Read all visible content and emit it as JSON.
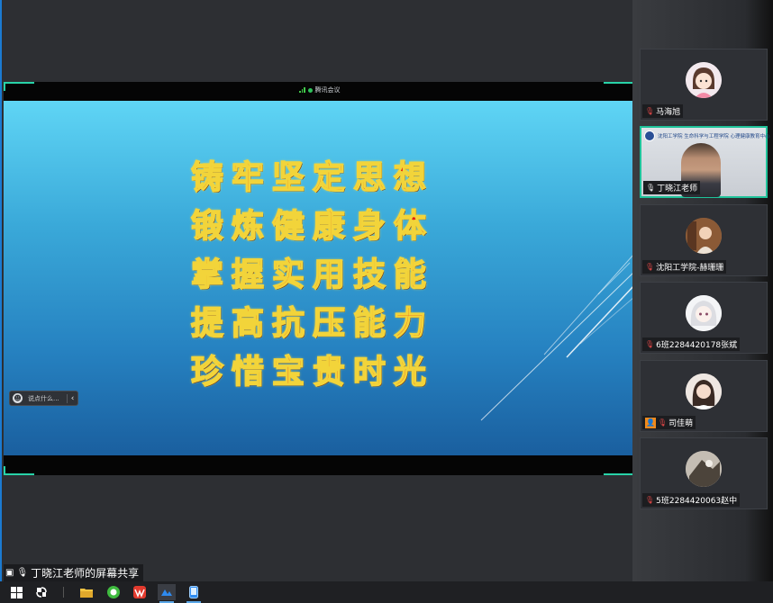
{
  "meeting": {
    "app_badge": "腾讯会议",
    "share_label": "丁晓江老师的屏幕共享"
  },
  "slide": {
    "lines": [
      "铸牢坚定思想",
      "锻炼健康身体",
      "掌握实用技能",
      "提高抗压能力",
      "珍惜宝贵时光"
    ]
  },
  "chat": {
    "placeholder": "说点什么..."
  },
  "participants": [
    {
      "name": "马海旭",
      "muted": true,
      "avatar": "cartoon-girl",
      "active": false
    },
    {
      "name": "丁晓江老师",
      "muted": false,
      "avatar": "video",
      "active": true
    },
    {
      "name": "沈阳工学院-赫珊珊",
      "muted": true,
      "avatar": "photo",
      "active": false
    },
    {
      "name": "6班2284420178张斌",
      "muted": true,
      "avatar": "anime",
      "active": false
    },
    {
      "name": "司佳萌",
      "muted": true,
      "avatar": "photo-girl",
      "active": false,
      "extra_icon": "person-icon"
    },
    {
      "name": "5班2284420063赵中",
      "muted": true,
      "avatar": "photo-dark",
      "active": false
    }
  ],
  "video_header": "沈阳工学院 生命科学与工程学院 心理健康教育中心",
  "colors": {
    "accent": "#1fc39a",
    "slogan_fill": "#e51d12",
    "slogan_outline": "#f2d43a",
    "muted_mic": "#e04646"
  },
  "taskbar": {
    "icons": [
      "windows-icon",
      "app-icon",
      "file-explorer-icon",
      "wechat-icon",
      "wps-icon",
      "tencent-meeting-icon",
      "phone-icon"
    ]
  }
}
